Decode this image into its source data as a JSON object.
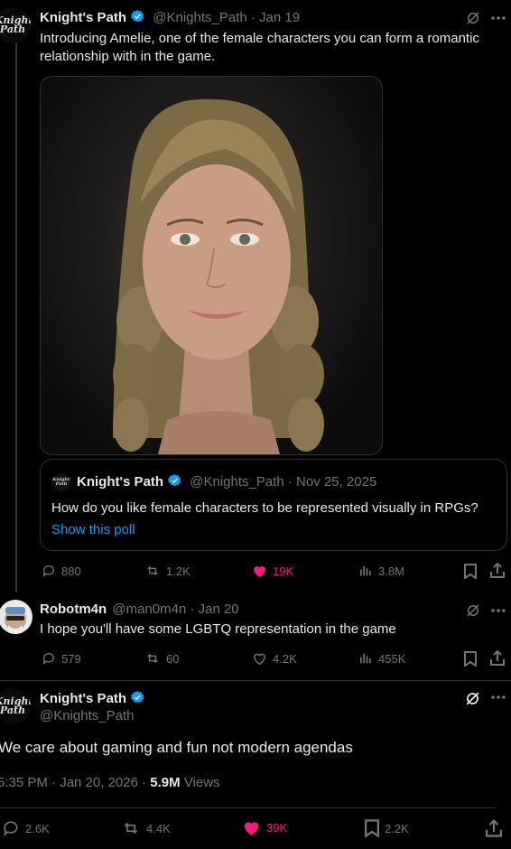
{
  "post1": {
    "display_name": "Knight's Path",
    "handle": "@Knights_Path",
    "date": "· Jan 19",
    "text": "Introducing Amelie, one of the female characters you can form a romantic relationship with in the game.",
    "quote": {
      "display_name": "Knight's Path",
      "handle": "@Knights_Path",
      "date": "· Nov 25, 2025",
      "text": "How do you like female characters to be represented visually in RPGs?",
      "link": "Show this poll"
    },
    "stats": {
      "replies": "880",
      "reposts": "1.2K",
      "likes": "19K",
      "views": "3.8M"
    }
  },
  "reply": {
    "display_name": "Robotm4n",
    "handle": "@man0m4n",
    "date": "· Jan 20",
    "text": "I hope you'll have some LGBTQ representation in the game",
    "stats": {
      "replies": "579",
      "reposts": "60",
      "likes": "4.2K",
      "views": "455K"
    }
  },
  "main": {
    "display_name": "Knight's Path",
    "handle": "@Knights_Path",
    "text": "We care about gaming and fun not modern agendas",
    "time": "5:35 PM · Jan 20, 2026 ·",
    "views_count": "5.9M",
    "views_label": "Views",
    "stats": {
      "replies": "2.6K",
      "reposts": "4.4K",
      "likes": "39K",
      "bookmarks": "2.2K"
    }
  },
  "logo_text": "Knight's Path",
  "colors": {
    "like_pink": "#f91880",
    "verified_blue": "#1d9bf0",
    "muted": "#71767b"
  }
}
